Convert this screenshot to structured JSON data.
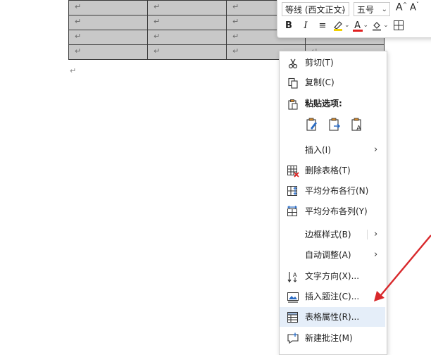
{
  "table": {
    "rows": [
      [
        "↵",
        "↵",
        "↵",
        "↵"
      ],
      [
        "↵",
        "↵",
        "↵",
        "↵"
      ],
      [
        "↵",
        "↵",
        "↵",
        "↵"
      ],
      [
        "↵",
        "↵",
        "↵",
        "↵"
      ]
    ],
    "after_mark": "↵"
  },
  "mini_toolbar": {
    "font_name": "等线 (西文正文)",
    "font_size": "五号",
    "grow_font_label": "A",
    "shrink_font_label": "A",
    "bold_label": "B",
    "italic_label": "I",
    "align_label": "≡",
    "font_color_label": "A"
  },
  "context_menu": {
    "cut": "剪切(T)",
    "copy": "复制(C)",
    "paste_options": "粘贴选项:",
    "insert": "插入(I)",
    "delete_table": "删除表格(T)",
    "distribute_rows": "平均分布各行(N)",
    "distribute_columns": "平均分布各列(Y)",
    "border_styles": "边框样式(B)",
    "autofit": "自动调整(A)",
    "text_direction": "文字方向(X)...",
    "insert_caption": "插入题注(C)...",
    "table_properties": "表格属性(R)...",
    "new_comment": "新建批注(M)"
  },
  "colors": {
    "highlight_yellow": "#f2d200",
    "font_red": "#e02020",
    "menu_hover": "#e5eef9",
    "annotation_arrow": "#d8282b"
  }
}
